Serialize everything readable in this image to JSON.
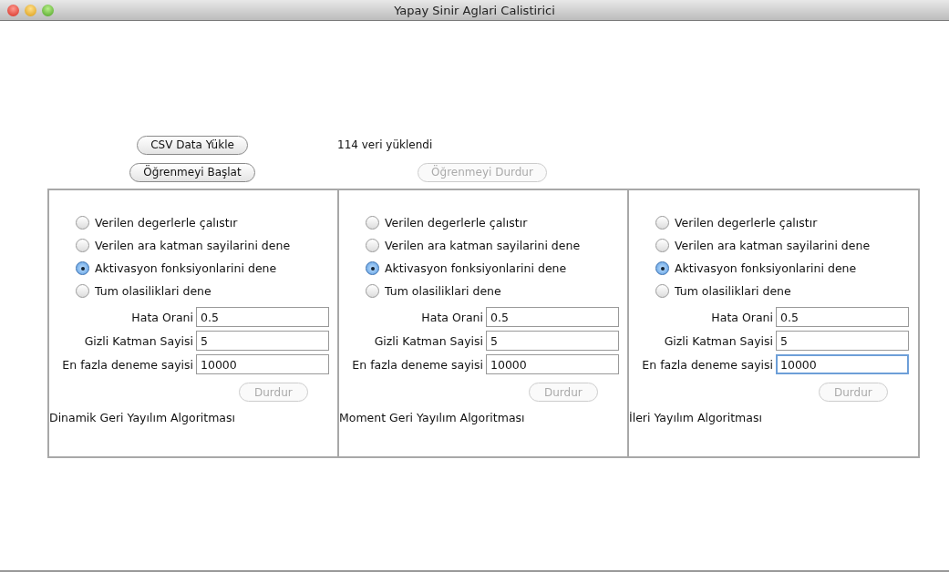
{
  "window": {
    "title": "Yapay Sinir Aglari Calistirici"
  },
  "load_button": {
    "label": "CSV Data Yükle",
    "disabled": false
  },
  "status": "114 veri yüklendi",
  "start_button": {
    "label": "Öğrenmeyi Başlat",
    "disabled": false
  },
  "stop_button": {
    "label": "Öğrenmeyi Durdur",
    "disabled": true
  },
  "panels": [
    {
      "options": [
        {
          "label": "Verilen degerlerle çalıstır",
          "selected": false
        },
        {
          "label": "Verilen ara katman sayilarini dene",
          "selected": false
        },
        {
          "label": "Aktivasyon fonksiyonlarini dene",
          "selected": true
        },
        {
          "label": "Tum olasiliklari dene",
          "selected": false
        }
      ],
      "fields": [
        {
          "label": "Hata Orani",
          "value": "0.5",
          "focused": false
        },
        {
          "label": "Gizli Katman Sayisi",
          "value": "5",
          "focused": false
        },
        {
          "label": "En fazla deneme sayisi",
          "value": "10000",
          "focused": false
        }
      ],
      "button": {
        "label": "Durdur",
        "disabled": true
      },
      "algorithm": "Dinamik Geri Yayılım Algoritması"
    },
    {
      "options": [
        {
          "label": "Verilen degerlerle çalıstır",
          "selected": false
        },
        {
          "label": "Verilen ara katman sayilarini dene",
          "selected": false
        },
        {
          "label": "Aktivasyon fonksiyonlarini dene",
          "selected": true
        },
        {
          "label": "Tum olasiliklari dene",
          "selected": false
        }
      ],
      "fields": [
        {
          "label": "Hata Orani",
          "value": "0.5",
          "focused": false
        },
        {
          "label": "Gizli Katman Sayisi",
          "value": "5",
          "focused": false
        },
        {
          "label": "En fazla deneme sayisi",
          "value": "10000",
          "focused": false
        }
      ],
      "button": {
        "label": "Durdur",
        "disabled": true
      },
      "algorithm": "Moment Geri Yayılım Algoritması"
    },
    {
      "options": [
        {
          "label": "Verilen degerlerle çalıstır",
          "selected": false
        },
        {
          "label": "Verilen ara katman sayilarini dene",
          "selected": false
        },
        {
          "label": "Aktivasyon fonksiyonlarini dene",
          "selected": true
        },
        {
          "label": "Tum olasiliklari dene",
          "selected": false
        }
      ],
      "fields": [
        {
          "label": "Hata Orani",
          "value": "0.5",
          "focused": false
        },
        {
          "label": "Gizli Katman Sayisi",
          "value": "5",
          "focused": false
        },
        {
          "label": "En fazla deneme sayisi",
          "value": "10000",
          "focused": true
        }
      ],
      "button": {
        "label": "Durdur",
        "disabled": true
      },
      "algorithm": "İleri Yayılım Algoritması"
    }
  ]
}
